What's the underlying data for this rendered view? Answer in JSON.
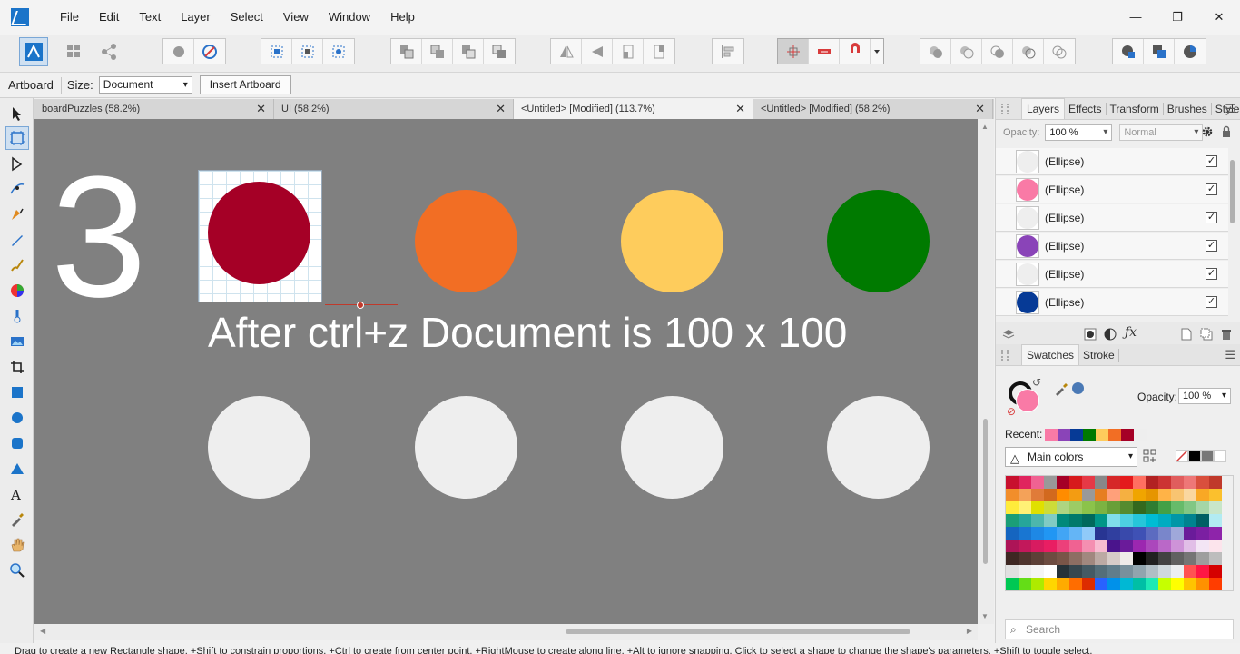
{
  "menu": [
    "File",
    "Edit",
    "Text",
    "Layer",
    "Select",
    "View",
    "Window",
    "Help"
  ],
  "window_controls": [
    "—",
    "❐",
    "✕"
  ],
  "context_bar": {
    "tool_label": "Artboard",
    "size_label": "Size:",
    "size_value": "Document",
    "insert_button": "Insert Artboard"
  },
  "doc_tabs": [
    {
      "title": "boardPuzzles (58.2%)",
      "active": false
    },
    {
      "title": "UI (58.2%)",
      "active": false
    },
    {
      "title": "<Untitled> [Modified] (113.7%)",
      "active": true
    },
    {
      "title": "<Untitled> [Modified] (58.2%)",
      "active": false
    }
  ],
  "canvas": {
    "big_number": "3",
    "caption": "After ctrl+z Document is 100 x 100",
    "circles_top": [
      "#a50026",
      "#f26e24",
      "#fecc5c",
      "#007a00"
    ],
    "circles_bottom": [
      "#eeeeee",
      "#eeeeee",
      "#eeeeee",
      "#eeeeee"
    ]
  },
  "layers_panel": {
    "tabs": [
      "Layers",
      "Effects",
      "Transform",
      "Brushes",
      "Styles"
    ],
    "opacity_label": "Opacity:",
    "opacity_value": "100 %",
    "blend_mode": "Normal",
    "layers": [
      {
        "name": "(Ellipse)",
        "color": "#eeeeee",
        "visible": true
      },
      {
        "name": "(Ellipse)",
        "color": "#f97aa6",
        "visible": true
      },
      {
        "name": "(Ellipse)",
        "color": "#eeeeee",
        "visible": true
      },
      {
        "name": "(Ellipse)",
        "color": "#8a44b8",
        "visible": true
      },
      {
        "name": "(Ellipse)",
        "color": "#eeeeee",
        "visible": true
      },
      {
        "name": "(Ellipse)",
        "color": "#063a96",
        "visible": true
      }
    ]
  },
  "swatches_panel": {
    "tabs": [
      "Swatches",
      "Stroke"
    ],
    "opacity_label": "Opacity:",
    "opacity_value": "100 %",
    "recent_label": "Recent:",
    "recent": [
      "#f97aa6",
      "#8a44b8",
      "#063a96",
      "#007a00",
      "#fecc5c",
      "#f26e24",
      "#a50026",
      "#eeeeee"
    ],
    "palette": "Main colors",
    "search_placeholder": "Search"
  },
  "status_text": "Drag to create a new Rectangle shape. +Shift to constrain proportions. +Ctrl to create from center point. +RightMouse to create along line. +Alt to ignore snapping. Click to select a shape to change the shape's parameters. +Shift to toggle select."
}
